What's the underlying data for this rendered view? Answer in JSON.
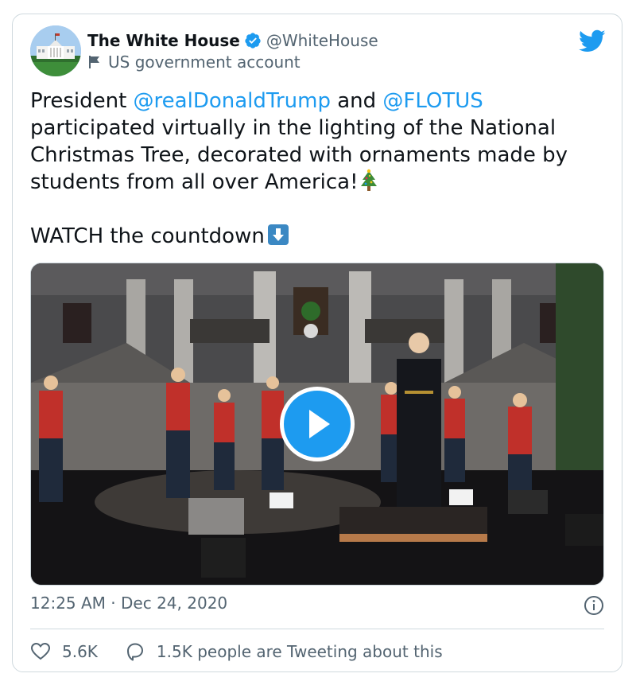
{
  "author": {
    "display_name": "The White House",
    "handle": "@WhiteHouse",
    "verified": true,
    "label": "US government account",
    "avatar_icon": "white-house-avatar"
  },
  "brand": {
    "icon": "twitter-bird-icon",
    "color": "#1d9bf0"
  },
  "tweet": {
    "text_1": "President ",
    "mention_1": "@realDonaldTrump",
    "text_2": " and ",
    "mention_2": "@FLOTUS",
    "text_3": " participated virtually in the lighting of the National Christmas Tree, decorated with ornaments made by students from all over America!",
    "emoji_1": "christmas-tree-emoji",
    "text_4": "WATCH the countdown",
    "emoji_2": "down-arrow-emoji"
  },
  "media": {
    "type": "video",
    "control": "play-button"
  },
  "meta": {
    "time": "12:25 AM",
    "separator": "·",
    "date": "Dec 24, 2020"
  },
  "actions": {
    "likes": "5.6K",
    "replies": "1.5K people are Tweeting about this"
  },
  "colors": {
    "link": "#1d9bf0",
    "secondary_text": "#536471",
    "border": "#cfd9de"
  }
}
